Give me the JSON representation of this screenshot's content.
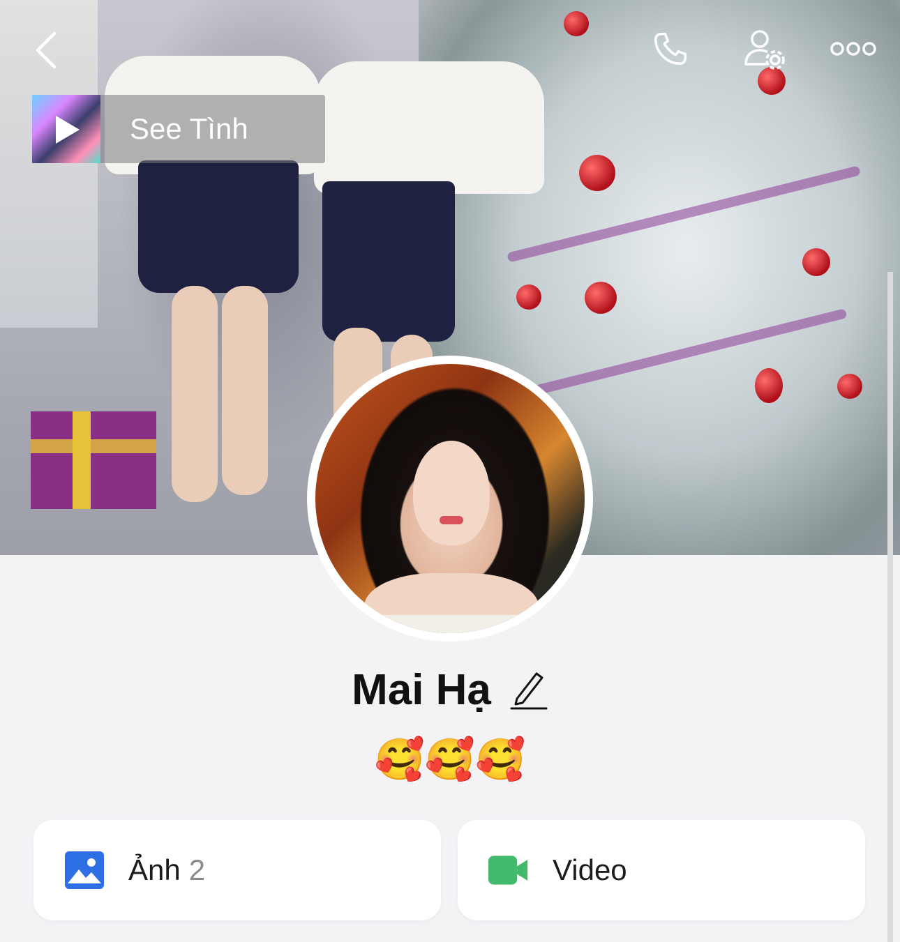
{
  "header": {
    "back_icon": "chevron-left-icon",
    "call_icon": "phone-icon",
    "settings_icon": "user-settings-icon",
    "more_icon": "more-horizontal-icon"
  },
  "music": {
    "title": "See Tình",
    "icon": "play-icon"
  },
  "profile": {
    "name": "Mai Hạ",
    "edit_icon": "pencil-icon",
    "status": "🥰🥰🥰"
  },
  "media": {
    "photos": {
      "label": "Ảnh",
      "count": "2",
      "icon": "image-icon",
      "color": "#2f6fe4"
    },
    "videos": {
      "label": "Video",
      "icon": "video-camera-icon",
      "color": "#43b96b"
    }
  }
}
